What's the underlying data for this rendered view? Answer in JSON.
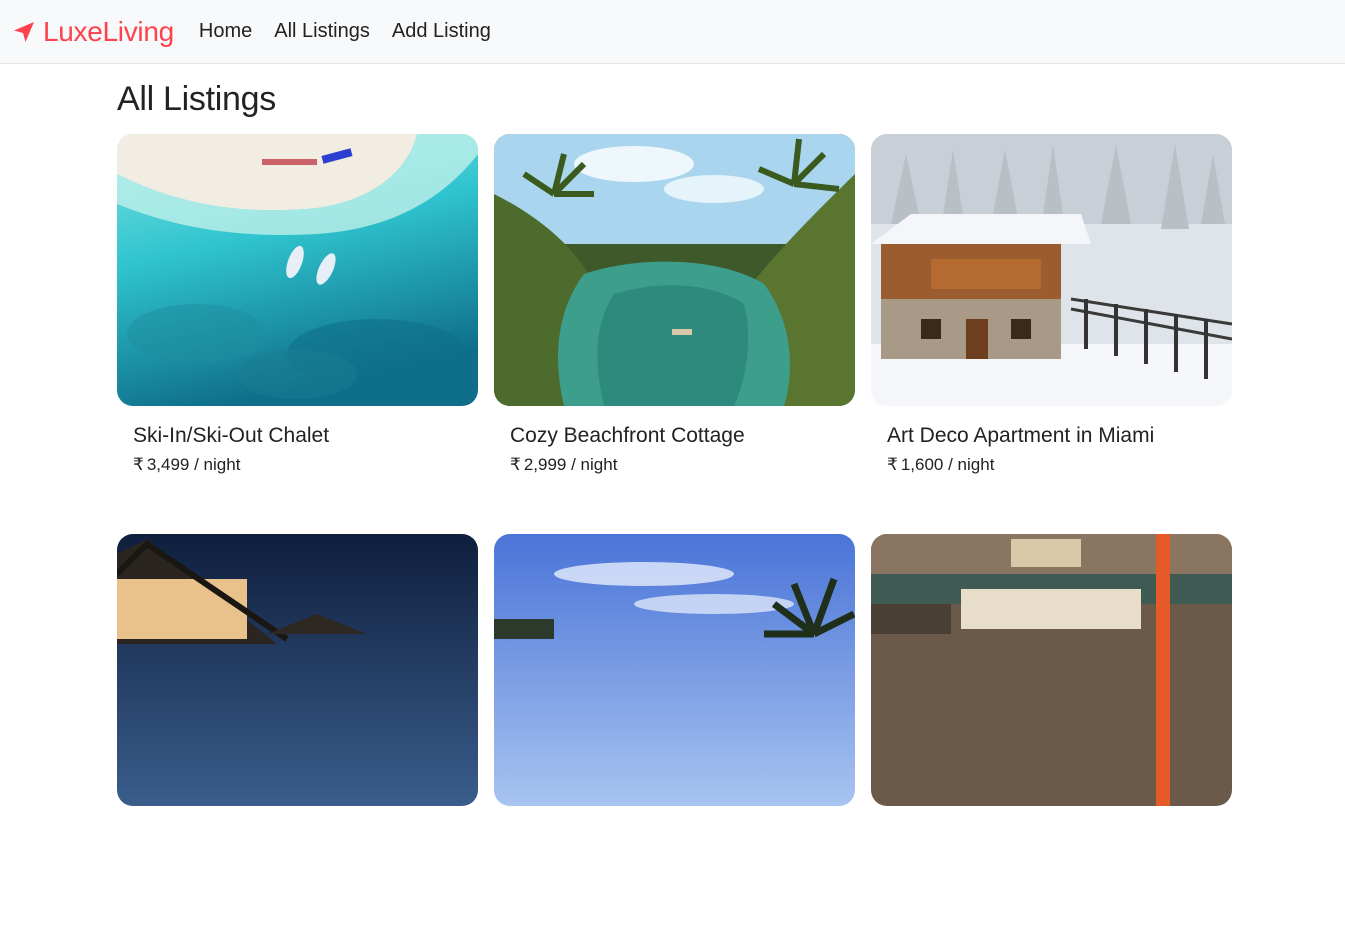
{
  "navbar": {
    "brand": "LuxeLiving",
    "brand_icon": "compass-arrow-icon",
    "brand_color": "#fe424d",
    "links": [
      {
        "label": "Home"
      },
      {
        "label": "All Listings"
      },
      {
        "label": "Add Listing"
      }
    ]
  },
  "page": {
    "title": "All Listings"
  },
  "listings": [
    {
      "title": "Ski-In/Ski-Out Chalet",
      "currency": "₹",
      "price": "3,499",
      "unit": "/ night",
      "image": "aerial-turquoise-beach-with-boats"
    },
    {
      "title": "Cozy Beachfront Cottage",
      "currency": "₹",
      "price": "2,999",
      "unit": "/ night",
      "image": "tropical-river-with-palm-trees-and-boat"
    },
    {
      "title": "Art Deco Apartment in Miami",
      "currency": "₹",
      "price": "1,600",
      "unit": "/ night",
      "image": "snowy-wooden-chalet-in-forest"
    },
    {
      "title": "",
      "currency": "",
      "price": "",
      "unit": "",
      "image": "lit-building-at-dusk"
    },
    {
      "title": "",
      "currency": "",
      "price": "",
      "unit": "",
      "image": "blue-sky-with-palm-tree"
    },
    {
      "title": "",
      "currency": "",
      "price": "",
      "unit": "",
      "image": "japanese-wooden-storefront"
    }
  ]
}
